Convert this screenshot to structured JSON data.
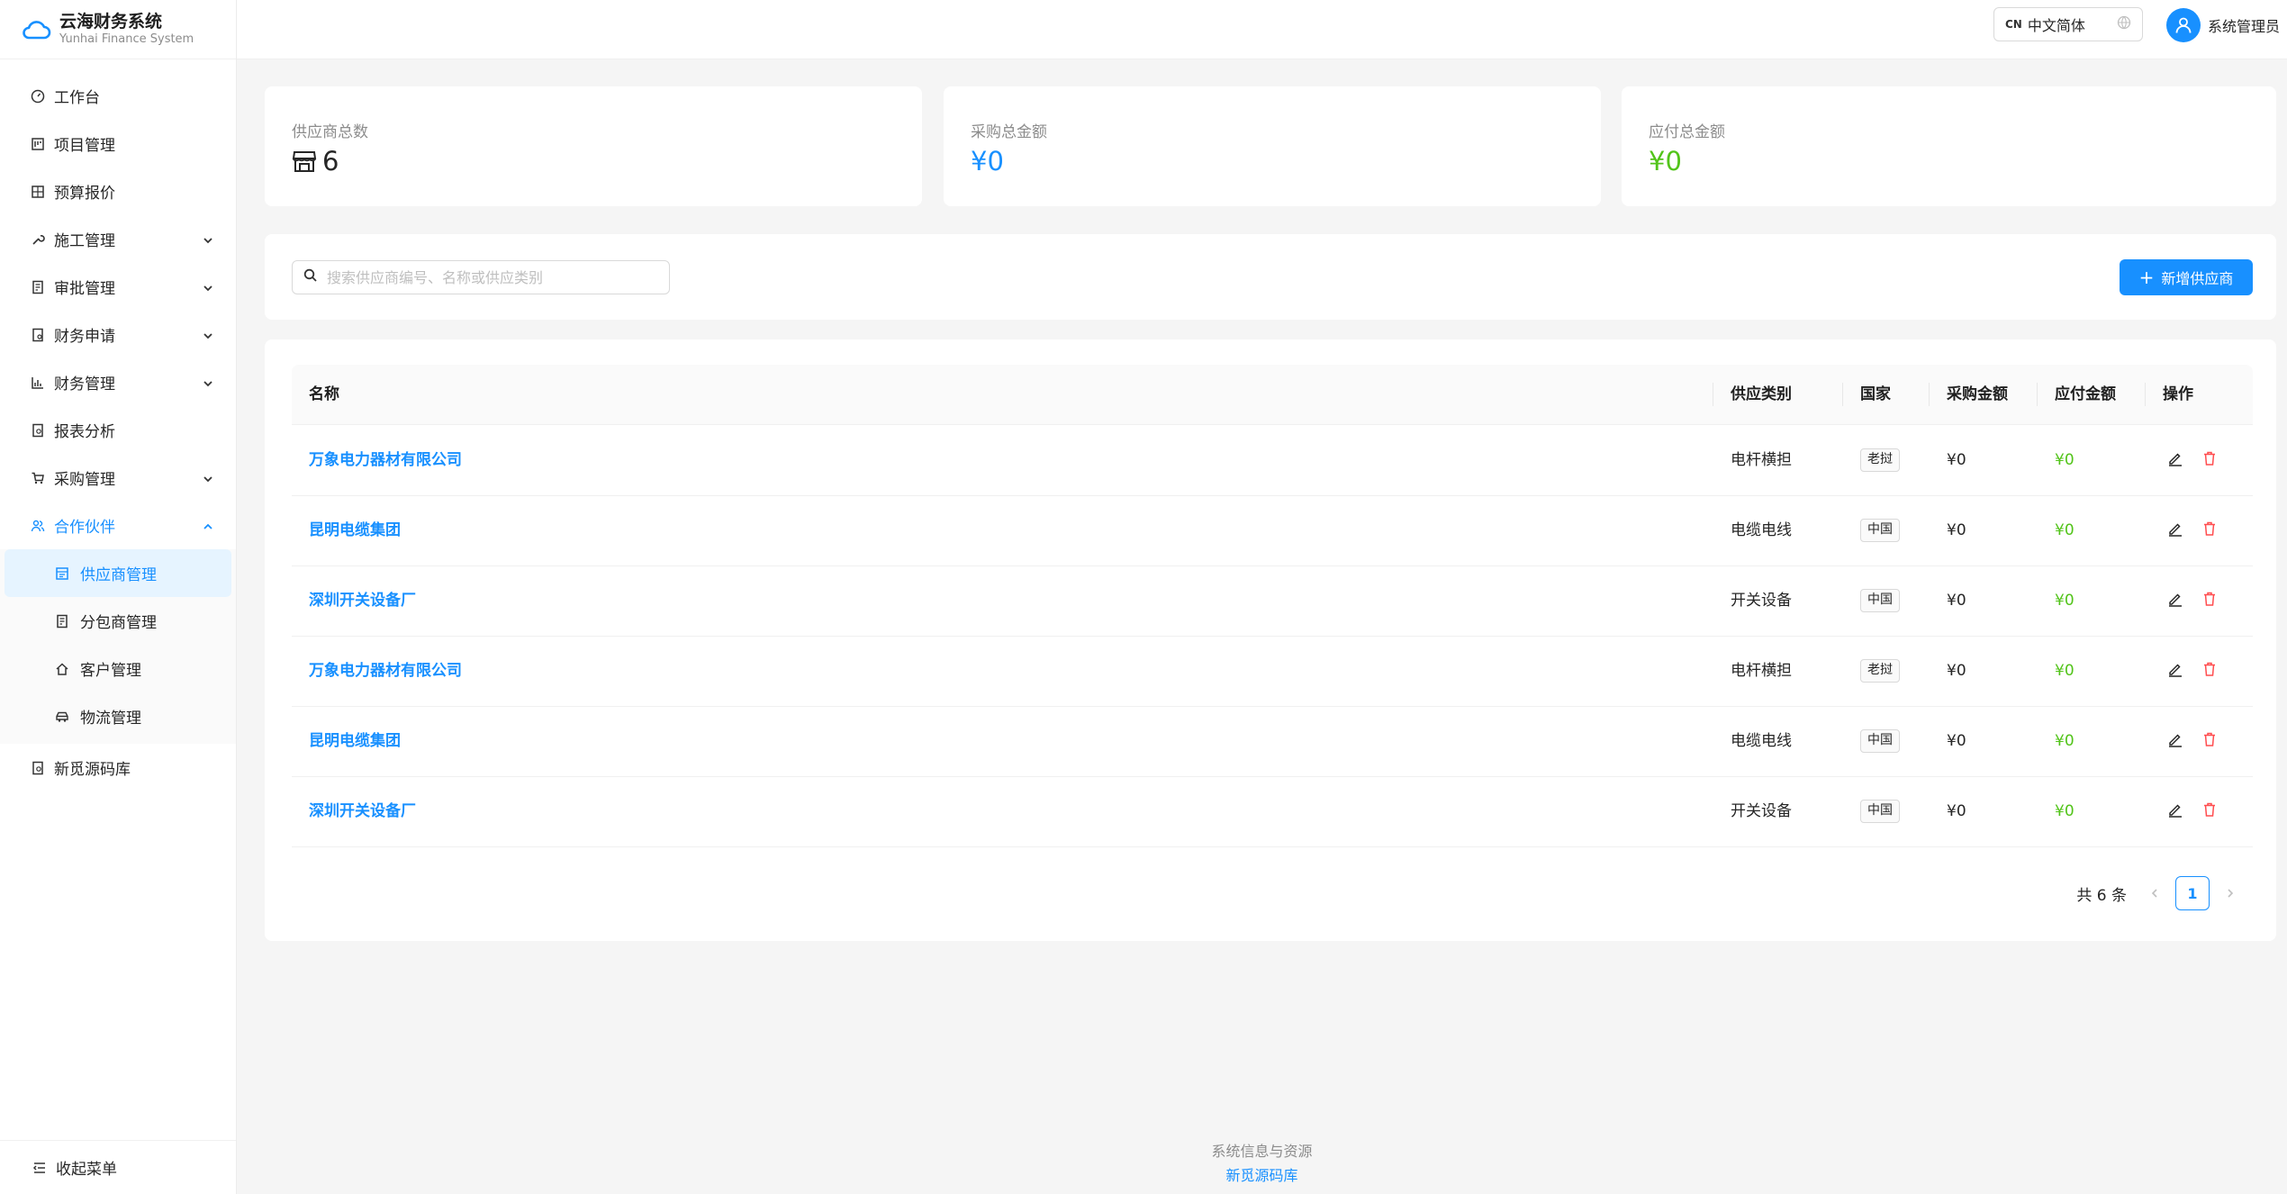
{
  "brand": {
    "title": "云海财务系统",
    "subtitle": "Yunhai Finance System"
  },
  "sidebar": {
    "items": [
      {
        "label": "工作台",
        "icon": "dashboard-icon"
      },
      {
        "label": "项目管理",
        "icon": "project-icon"
      },
      {
        "label": "预算报价",
        "icon": "calculator-icon"
      },
      {
        "label": "施工管理",
        "icon": "tool-icon"
      },
      {
        "label": "审批管理",
        "icon": "audit-icon"
      },
      {
        "label": "财务申请",
        "icon": "file-icon"
      },
      {
        "label": "财务管理",
        "icon": "bar-chart-icon"
      },
      {
        "label": "报表分析",
        "icon": "report-icon"
      },
      {
        "label": "采购管理",
        "icon": "cart-icon"
      },
      {
        "label": "合作伙伴",
        "icon": "partner-icon"
      }
    ],
    "partner_sub": [
      {
        "label": "供应商管理",
        "icon": "supplier-icon"
      },
      {
        "label": "分包商管理",
        "icon": "subcontractor-icon"
      },
      {
        "label": "客户管理",
        "icon": "home-icon"
      },
      {
        "label": "物流管理",
        "icon": "car-icon"
      }
    ],
    "bottom_item": {
      "label": "新觅源码库",
      "icon": "code-library-icon"
    },
    "collapse_label": "收起菜单"
  },
  "header": {
    "lang_code": "CN",
    "lang_label": "中文简体",
    "user_name": "系统管理员"
  },
  "stats": [
    {
      "label": "供应商总数",
      "value": "6"
    },
    {
      "label": "采购总金额",
      "value": "¥0"
    },
    {
      "label": "应付总金额",
      "value": "¥0"
    }
  ],
  "toolbar": {
    "search_placeholder": "搜索供应商编号、名称或供应类别",
    "add_label": "新增供应商"
  },
  "table": {
    "columns": [
      "名称",
      "供应类别",
      "国家",
      "采购金额",
      "应付金额",
      "操作"
    ],
    "rows": [
      {
        "name": "万象电力器材有限公司",
        "category": "电杆横担",
        "country": "老挝",
        "purchase": "¥0",
        "payable": "¥0"
      },
      {
        "name": "昆明电缆集团",
        "category": "电缆电线",
        "country": "中国",
        "purchase": "¥0",
        "payable": "¥0"
      },
      {
        "name": "深圳开关设备厂",
        "category": "开关设备",
        "country": "中国",
        "purchase": "¥0",
        "payable": "¥0"
      },
      {
        "name": "万象电力器材有限公司",
        "category": "电杆横担",
        "country": "老挝",
        "purchase": "¥0",
        "payable": "¥0"
      },
      {
        "name": "昆明电缆集团",
        "category": "电缆电线",
        "country": "中国",
        "purchase": "¥0",
        "payable": "¥0"
      },
      {
        "name": "深圳开关设备厂",
        "category": "开关设备",
        "country": "中国",
        "purchase": "¥0",
        "payable": "¥0"
      }
    ]
  },
  "pagination": {
    "total_label": "共 6 条",
    "current_page": "1"
  },
  "footer": {
    "line1": "系统信息与资源",
    "line2": "新觅源码库"
  },
  "colors": {
    "primary": "#1890ff",
    "success": "#52c41a",
    "danger": "#ff4d4f"
  }
}
